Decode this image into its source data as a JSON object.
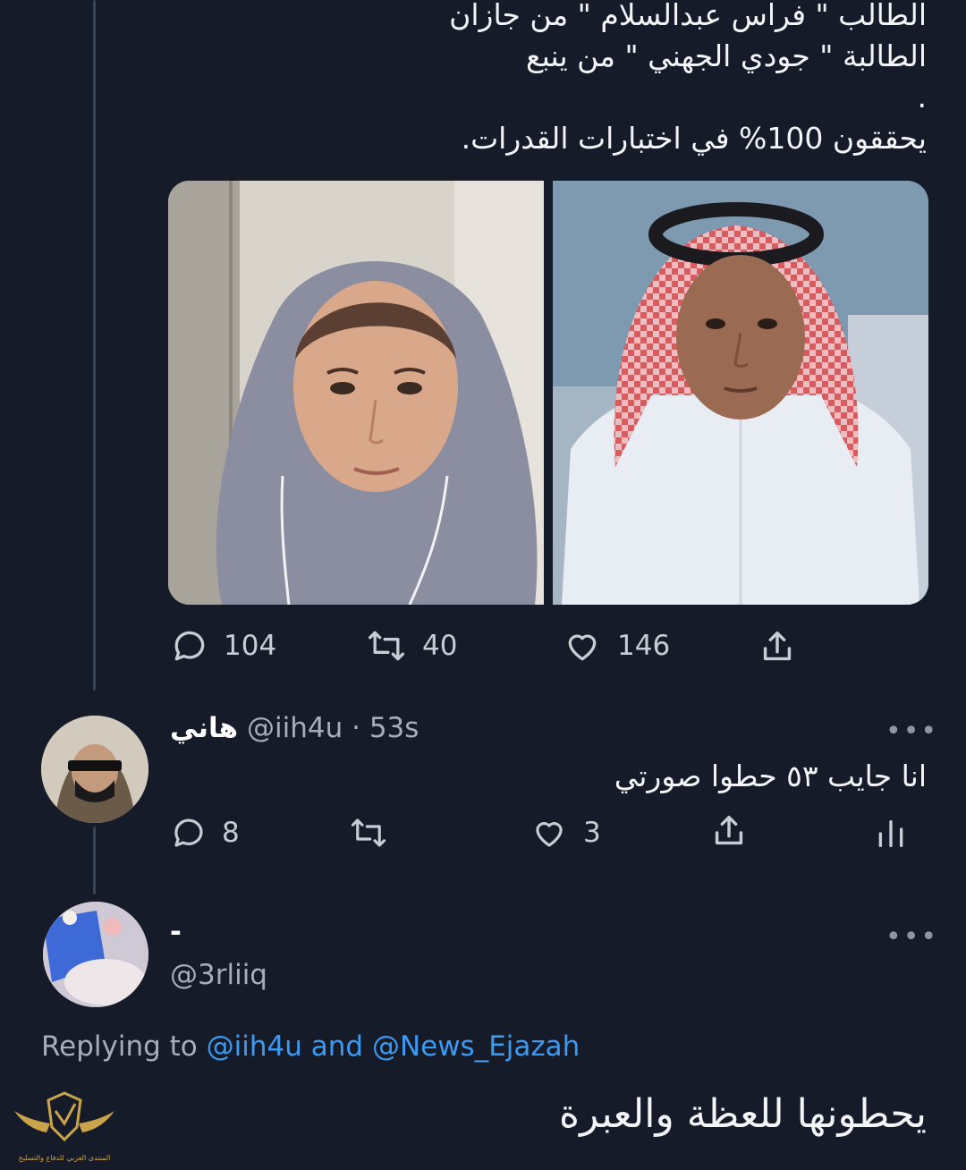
{
  "tweet": {
    "lines": [
      "الطالب \" فراس عبدالسلام \" من جازان",
      "الطالبة \" جودي الجهني \" من ينبع",
      ".",
      "يحققون 100% في اختبارات القدرات."
    ],
    "media": [
      {
        "description_icon": "photo-female-student"
      },
      {
        "description_icon": "photo-male-student"
      }
    ],
    "actions": {
      "replies": "104",
      "retweets": "40",
      "likes": "146"
    }
  },
  "reply1": {
    "name": "هاني",
    "handle": "@iih4u",
    "time": "· 53s",
    "text": "انا جايب ٥٣ حطوا صورتي",
    "actions": {
      "replies": "8",
      "retweets": "",
      "likes": "3"
    },
    "more": "•••"
  },
  "reply2": {
    "name": "-",
    "handle": "@3rliiq",
    "more": "•••",
    "replying_prefix": "Replying to",
    "replying_user1": "@iih4u",
    "replying_and": "and",
    "replying_user2": "@News_Ejazah",
    "text": "يحطونها للعظة والعبرة"
  },
  "watermark": {
    "text": "المنتدى العربي للدفاع والتسليح"
  },
  "colors": {
    "background": "#151b28",
    "link": "#3d9af2",
    "muted": "#a8aeb8"
  }
}
